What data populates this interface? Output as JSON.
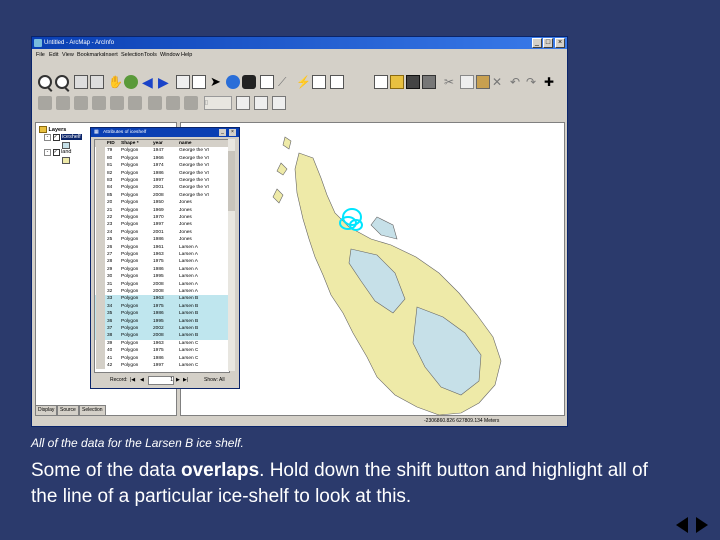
{
  "window": {
    "title": "Untitled - ArcMap - ArcInfo",
    "controls": [
      "_",
      "□",
      "×"
    ]
  },
  "menu": [
    "File",
    "Edit",
    "View",
    "Bookmarks",
    "Insert",
    "Selection",
    "Tools",
    "Window",
    "Help"
  ],
  "toolbar": {
    "scale_placeholder": "[]"
  },
  "toc": {
    "root": "Layers",
    "layers": [
      {
        "name": "iceshelf",
        "checked": true,
        "selected": true
      },
      {
        "name": "land",
        "checked": true,
        "selected": false
      }
    ]
  },
  "attribute_table": {
    "title": "Attributes of iceshelf",
    "columns": [
      "FID",
      "Shape *",
      "year",
      "name"
    ],
    "rows": [
      [
        "79",
        "Polygon",
        "1947",
        "George the VI"
      ],
      [
        "80",
        "Polygon",
        "1966",
        "George the VI"
      ],
      [
        "81",
        "Polygon",
        "1974",
        "George the VI"
      ],
      [
        "82",
        "Polygon",
        "1986",
        "George the VI"
      ],
      [
        "83",
        "Polygon",
        "1997",
        "George the VI"
      ],
      [
        "84",
        "Polygon",
        "2001",
        "George the VI"
      ],
      [
        "85",
        "Polygon",
        "2008",
        "George the VI"
      ],
      [
        "20",
        "Polygon",
        "1950",
        "Jones"
      ],
      [
        "21",
        "Polygon",
        "1969",
        "Jones"
      ],
      [
        "22",
        "Polygon",
        "1970",
        "Jones"
      ],
      [
        "23",
        "Polygon",
        "1997",
        "Jones"
      ],
      [
        "24",
        "Polygon",
        "2001",
        "Jones"
      ],
      [
        "25",
        "Polygon",
        "1986",
        "Jones"
      ],
      [
        "26",
        "Polygon",
        "1961",
        "Larsen A"
      ],
      [
        "27",
        "Polygon",
        "1963",
        "Larsen A"
      ],
      [
        "28",
        "Polygon",
        "1975",
        "Larsen A"
      ],
      [
        "29",
        "Polygon",
        "1986",
        "Larsen A"
      ],
      [
        "30",
        "Polygon",
        "1995",
        "Larsen A"
      ],
      [
        "31",
        "Polygon",
        "2008",
        "Larsen A"
      ],
      [
        "32",
        "Polygon",
        "2008",
        "Larsen A"
      ],
      [
        "33",
        "Polygon",
        "1963",
        "Larsen B"
      ],
      [
        "34",
        "Polygon",
        "1975",
        "Larsen B"
      ],
      [
        "35",
        "Polygon",
        "1986",
        "Larsen B"
      ],
      [
        "36",
        "Polygon",
        "1995",
        "Larsen B"
      ],
      [
        "37",
        "Polygon",
        "2002",
        "Larsen B"
      ],
      [
        "38",
        "Polygon",
        "2008",
        "Larsen B"
      ],
      [
        "39",
        "Polygon",
        "1963",
        "Larsen C"
      ],
      [
        "40",
        "Polygon",
        "1975",
        "Larsen C"
      ],
      [
        "41",
        "Polygon",
        "1986",
        "Larsen C"
      ],
      [
        "42",
        "Polygon",
        "1997",
        "Larsen C"
      ]
    ],
    "selected_rows": [
      20,
      21,
      22,
      23,
      24,
      25
    ],
    "footer": {
      "record_label": "Record:",
      "record_value": "1",
      "show_label": "Show:",
      "show_value": "All"
    }
  },
  "view_tabs": [
    "Display",
    "Source",
    "Selection"
  ],
  "status": {
    "coordinates": "-2306860.826 627809.134 Meters"
  },
  "slide": {
    "caption": "All of the data for the Larsen B ice shelf.",
    "body_pre": "Some of the data ",
    "body_bold": "overlaps",
    "body_post": ". Hold down the shift button and highlight all of the line of a particular ice-shelf to look at this."
  },
  "colors": {
    "background": "#2b3a6c",
    "land": "#eeeaa8",
    "ice": "#c6e0e8",
    "selection": "#00e5ff"
  }
}
